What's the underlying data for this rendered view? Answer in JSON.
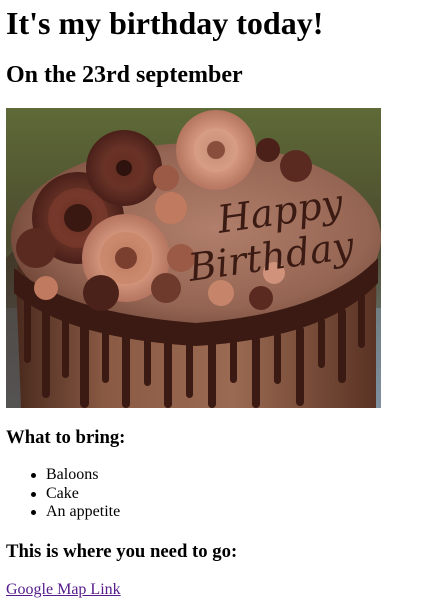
{
  "header": {
    "title": "It's my birthday today!",
    "subtitle": "On the 23rd september"
  },
  "photo": {
    "alt": "Chocolate birthday cake with frosting roses and 'Happy Birthday' written in chocolate",
    "inscription_line1": "Happy",
    "inscription_line2": "Birthday",
    "colors": {
      "background_top": "#5e6a37",
      "background_bottom": "#7d8fa0",
      "frosting": "#9a6a58",
      "drip": "#3a1a12",
      "cake_side": "#8a5a44",
      "rose_dark": "#5a2a22",
      "rose_light": "#c98a72"
    }
  },
  "bring_section": {
    "heading": "What to bring:",
    "items": [
      "Baloons",
      "Cake",
      "An appetite"
    ]
  },
  "go_section": {
    "heading": "This is where you need to go:",
    "link_text": "Google Map Link"
  },
  "colors": {
    "link_visited": "#551a8b",
    "text": "#000000",
    "background": "#ffffff"
  }
}
